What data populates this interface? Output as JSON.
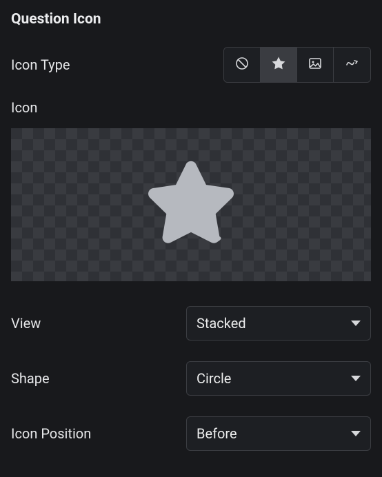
{
  "panel": {
    "title": "Question Icon"
  },
  "iconType": {
    "label": "Icon Type",
    "options": [
      "none",
      "icon",
      "image",
      "lottie"
    ],
    "selected": "icon"
  },
  "iconSection": {
    "label": "Icon",
    "previewIcon": "star"
  },
  "fields": {
    "view": {
      "label": "View",
      "value": "Stacked"
    },
    "shape": {
      "label": "Shape",
      "value": "Circle"
    },
    "iconPosition": {
      "label": "Icon Position",
      "value": "Before"
    }
  },
  "colors": {
    "previewStar": "#b6b9bf"
  }
}
